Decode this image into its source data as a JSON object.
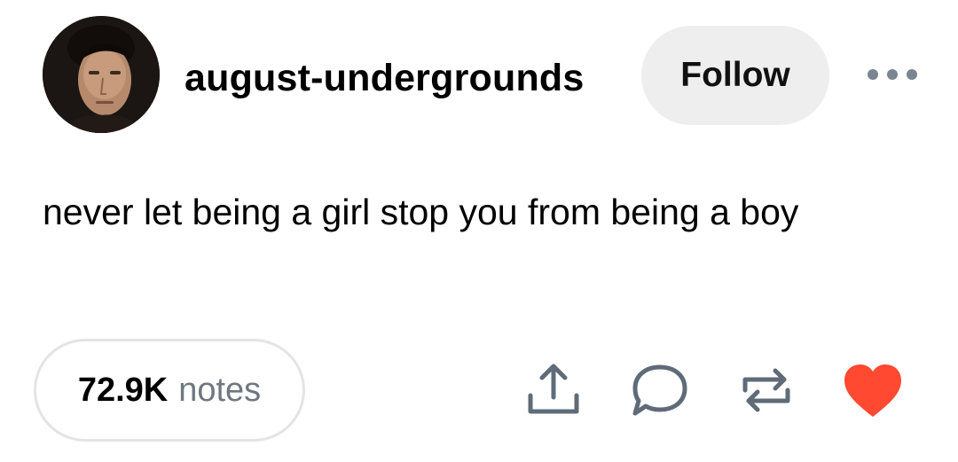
{
  "post": {
    "author": {
      "username": "august-undergrounds",
      "avatar_icon": "avatar-photo"
    },
    "follow_label": "Follow",
    "more_icon": "more-options-icon",
    "text": "never let being a girl stop you from being a boy",
    "notes": {
      "count": "72.9K",
      "label": "notes"
    },
    "actions": [
      {
        "name": "share",
        "icon": "share-icon"
      },
      {
        "name": "reply",
        "icon": "reply-icon"
      },
      {
        "name": "reblog",
        "icon": "reblog-icon"
      },
      {
        "name": "like",
        "icon": "heart-icon"
      }
    ]
  },
  "colors": {
    "follow_bg": "#eeeeee",
    "icon_gray": "#5f6b78",
    "heart": "#ff4930",
    "notes_label": "#707780",
    "pill_border": "#e4e4e4"
  }
}
